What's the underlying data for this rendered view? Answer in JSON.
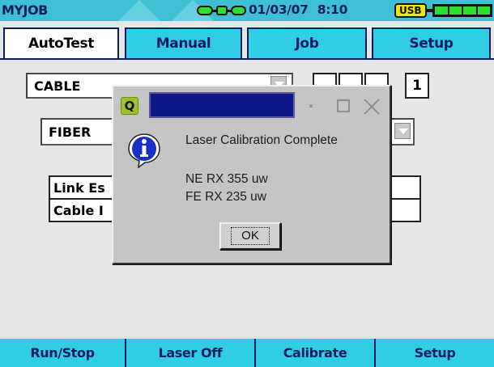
{
  "status": {
    "title": "MYJOB",
    "date": "01/03/07",
    "time": "8:10",
    "usb_badge": "USB",
    "battery_level": 1.0,
    "link_icon": "link-status-icon"
  },
  "tabs": [
    {
      "label": "AutoTest",
      "active": true
    },
    {
      "label": "Manual",
      "active": false
    },
    {
      "label": "Job",
      "active": false
    },
    {
      "label": "Setup",
      "active": false
    }
  ],
  "background": {
    "cable_select": "CABLE",
    "fiber_select": "FIBER",
    "digit_last": "1",
    "field1_visible": "Link Es",
    "field2_visible": "Cable I"
  },
  "dialog": {
    "app_icon_letter": "Q",
    "message": "Laser Calibration Complete",
    "lines": [
      "NE RX 355 uw",
      "FE RX 235 uw"
    ],
    "ok_label": "OK",
    "icons": [
      "app-icon",
      "minimize-icon",
      "maximize-icon",
      "close-icon",
      "info-icon"
    ]
  },
  "function_keys": [
    {
      "label": "Run/Stop"
    },
    {
      "label": "Laser Off"
    },
    {
      "label": "Calibrate"
    },
    {
      "label": "Setup"
    }
  ],
  "colors": {
    "accent_cyan": "#2fcde6",
    "title_navy": "#0c1d5e",
    "dialog_title_blue": "#0e1a8a",
    "battery_green": "#2ee02e",
    "usb_yellow": "#f1e600"
  }
}
